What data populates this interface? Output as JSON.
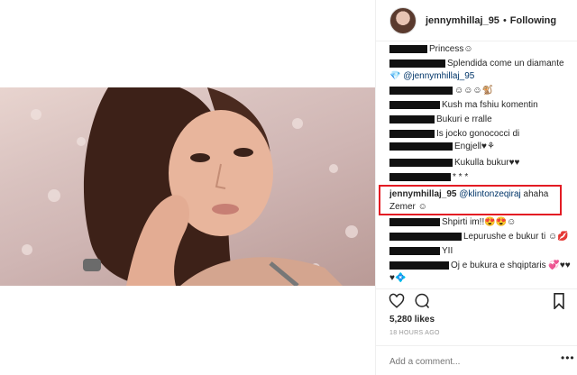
{
  "header": {
    "username": "jennymhillaj_95",
    "separator": "•",
    "follow_status": "Following"
  },
  "comments": [
    {
      "text": "Princess☺"
    },
    {
      "text": "Splendida come un diamante",
      "line2": "💎 @jennymhillaj_95"
    },
    {
      "text": "☺☺☺🐒"
    },
    {
      "text": "Kush ma fshiu komentin"
    },
    {
      "text": "Bukuri e rralle"
    },
    {
      "text": "Is jocko gonococci di",
      "line2": "Engjell♥⚘"
    },
    {
      "text": "Kukulla bukur♥♥"
    },
    {
      "text": "* * *"
    },
    {
      "username": "jennymhillaj_95",
      "mention": "@klintonzeqiraj",
      "text": " ahaha",
      "line2": "Zemer ☺"
    },
    {
      "text": "Shpirti im!!😍😍☺"
    },
    {
      "text": "Lepurushe e bukur ti ☺💋"
    },
    {
      "text": "YII"
    },
    {
      "text": "Oj e bukura e shqiptaris 💞♥♥",
      "line2": "♥💠"
    }
  ],
  "actions": {
    "likes": "5,280 likes",
    "time": "18 HOURS AGO"
  },
  "add_comment": {
    "placeholder": "Add a comment...",
    "more": "•••"
  }
}
